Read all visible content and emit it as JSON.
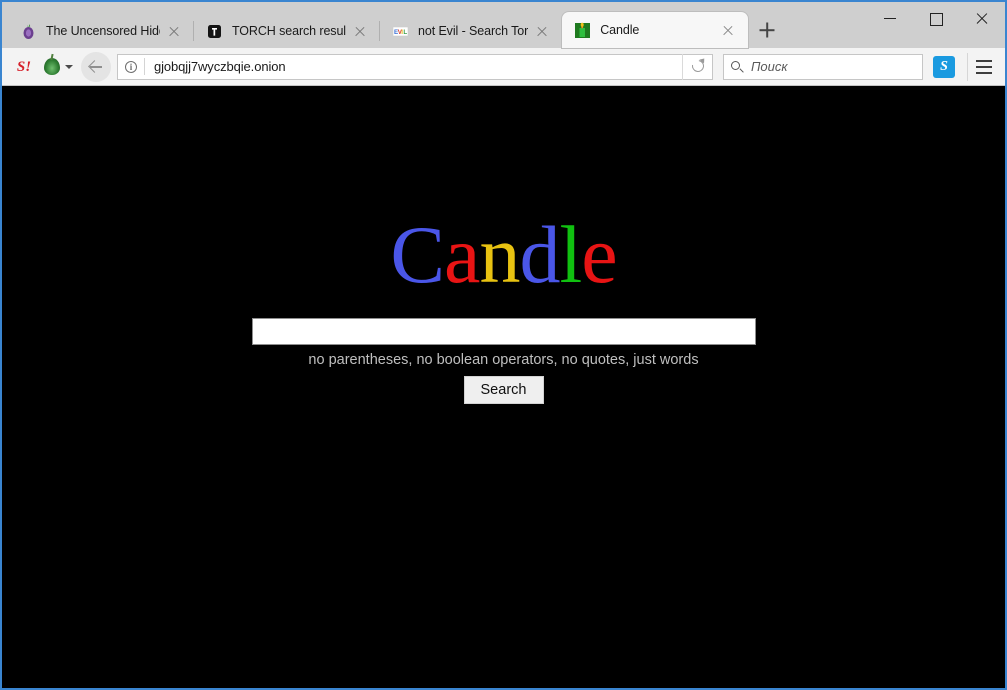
{
  "window": {
    "controls": {
      "minimize": "minimize",
      "maximize": "maximize",
      "close": "close"
    },
    "border_color": "#3a85d0"
  },
  "tabs": [
    {
      "title": "The Uncensored Hidde...",
      "favicon": "tor-onion-icon",
      "active": false
    },
    {
      "title": "TORCH search results f...",
      "favicon": "torch-icon",
      "active": false
    },
    {
      "title": "not Evil - Search Tor",
      "favicon": "notevil-icon",
      "active": false
    },
    {
      "title": "Candle",
      "favicon": "candle-icon",
      "active": true
    }
  ],
  "new_tab": {
    "label": "+",
    "name": "new-tab-button"
  },
  "toolbar": {
    "sputnik_label": "S",
    "sputnik_accent": "!",
    "torbutton_name": "onion-icon",
    "back_label": "Back",
    "site_info_glyph": "i",
    "url": "gjobqjj7wyczbqie.onion",
    "reload_label": "Reload",
    "search_placeholder": "Поиск",
    "skype_label": "S",
    "menu_label": "Open menu"
  },
  "page": {
    "background": "#000000",
    "logo": {
      "text": "Candle",
      "letters": [
        {
          "char": "C",
          "color": "#4a56e8"
        },
        {
          "char": "a",
          "color": "#e81414"
        },
        {
          "char": "n",
          "color": "#e8c211"
        },
        {
          "char": "d",
          "color": "#4a56e8"
        },
        {
          "char": "l",
          "color": "#10c010"
        },
        {
          "char": "e",
          "color": "#e81414"
        }
      ]
    },
    "search": {
      "value": "",
      "placeholder": "",
      "hint": "no parentheses, no boolean operators, no quotes, just words",
      "button_label": "Search"
    }
  }
}
